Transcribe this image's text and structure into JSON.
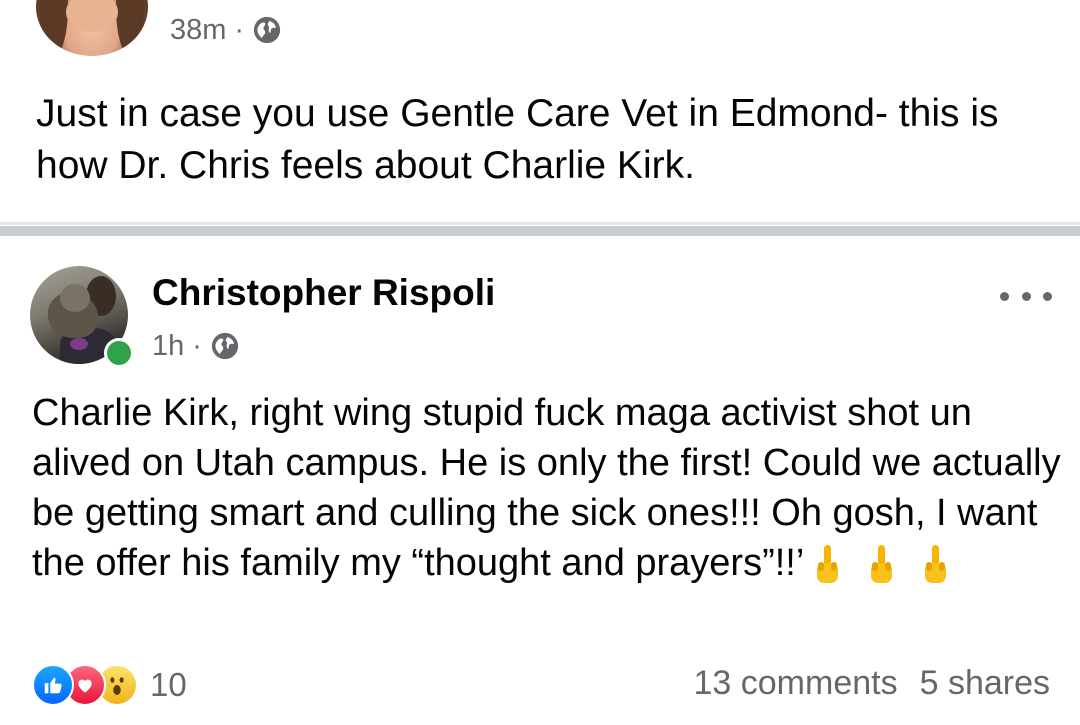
{
  "outer_post": {
    "timestamp": "38m",
    "separator": "·",
    "audience_icon": "globe-icon",
    "text": "Just in case you use Gentle Care Vet in Edmond- this is how Dr. Chris feels about Charlie Kirk."
  },
  "shared_post": {
    "author_name": "Christopher Rispoli",
    "timestamp": "1h",
    "separator": "·",
    "audience_icon": "globe-icon",
    "online_status_color": "#31a24c",
    "more_icon": "more-horizontal-icon",
    "text": "Charlie Kirk, right wing stupid fuck maga activist shot un alived on Utah campus. He is only the first! Could we actually be getting smart and culling the sick ones!!!  Oh gosh, I want the offer his family my “thought and prayers”!!’",
    "emoji": [
      "middle-finger-emoji",
      "middle-finger-emoji",
      "middle-finger-emoji"
    ]
  },
  "footer": {
    "reaction_icons": [
      "like-reaction-icon",
      "love-reaction-icon",
      "wow-reaction-icon"
    ],
    "reaction_count": "10",
    "comments": "13 comments",
    "shares": "5 shares"
  },
  "colors": {
    "meta_gray": "#65676b",
    "divider": "#c9ccd1",
    "like_blue": "#0866ff",
    "love_red": "#e61739",
    "wow_yellow": "#f7c02b"
  }
}
